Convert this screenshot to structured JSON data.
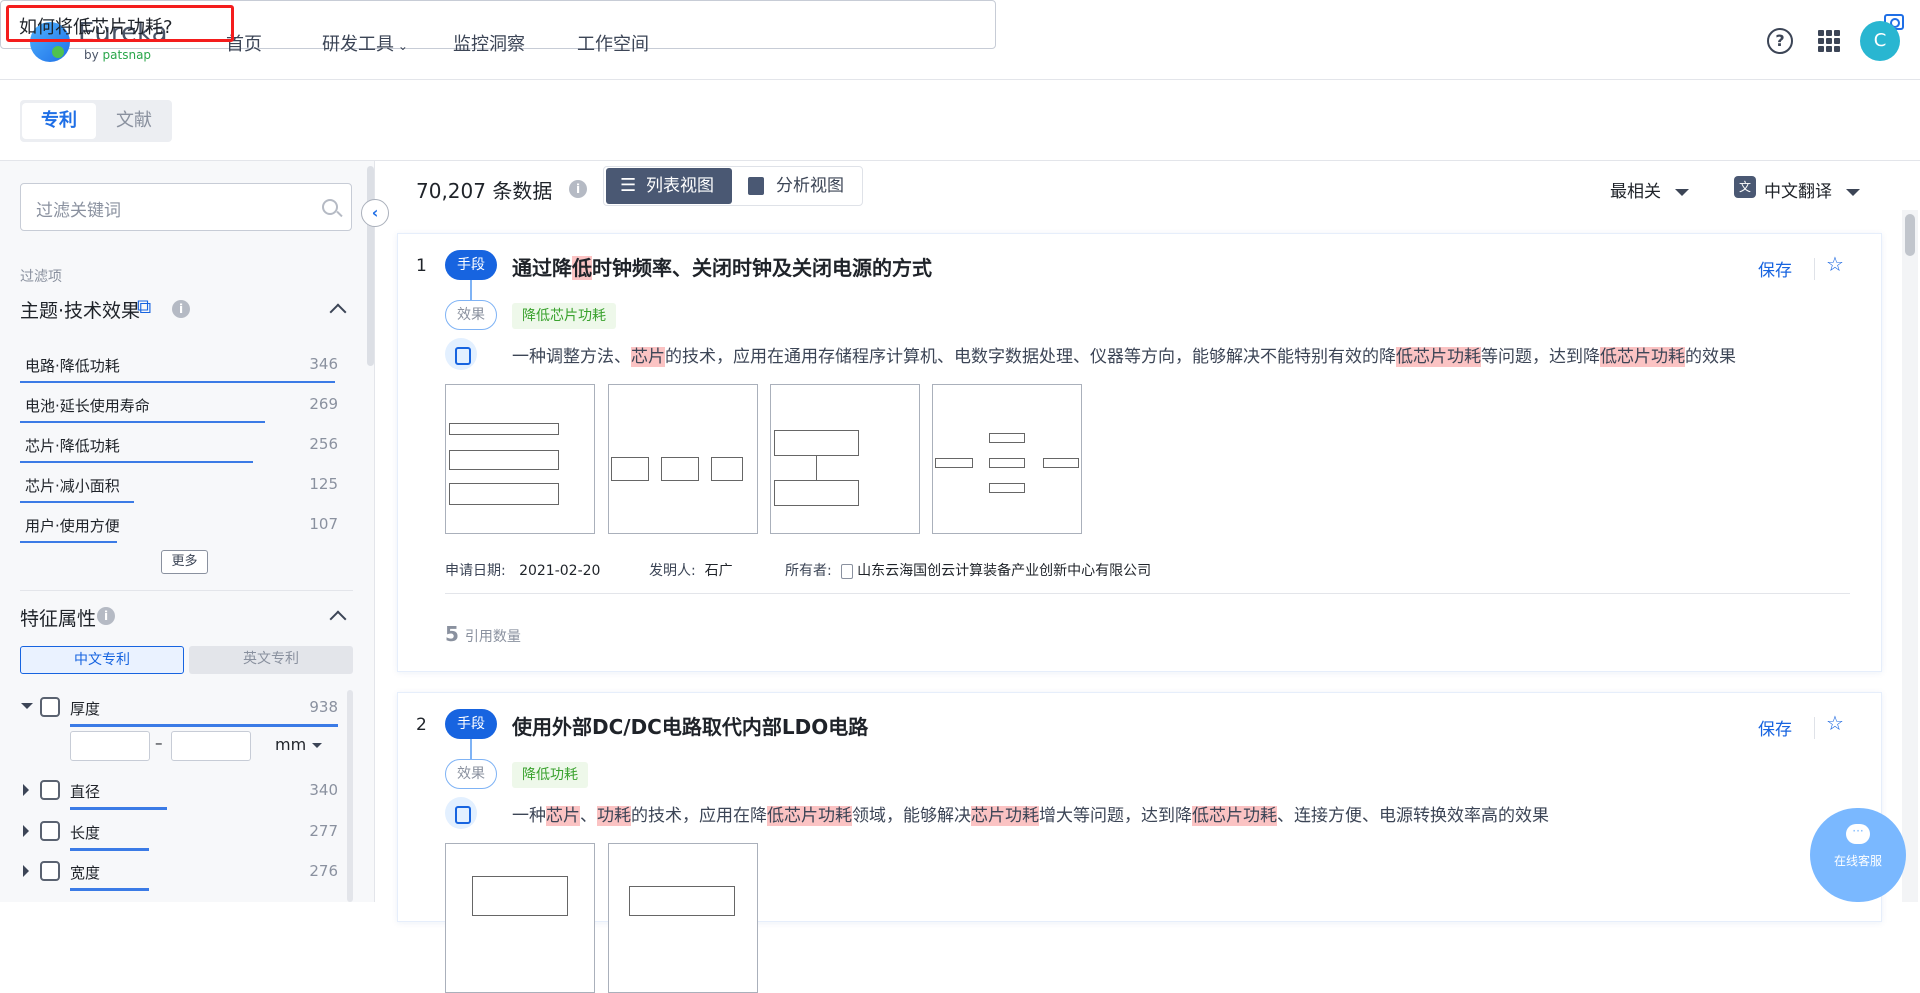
{
  "header": {
    "logo": "Eureka",
    "logo_sub_by": "by ",
    "logo_sub_brand": "patsnap",
    "nav": [
      "首页",
      "研发工具",
      "监控洞察",
      "工作空间"
    ],
    "search_value": "如何将低芯片功耗?",
    "avatar": "C",
    "help": "?"
  },
  "tabs": {
    "patent": "专利",
    "literature": "文献"
  },
  "sidebar": {
    "filter_placeholder": "过滤关键词",
    "filter_section": "过滤项",
    "topic_title": "主题·技术效果",
    "info": "i",
    "topics": [
      {
        "label": "电路·降低功耗",
        "count": 346
      },
      {
        "label": "电池·延长使用寿命",
        "count": 269
      },
      {
        "label": "芯片·降低功耗",
        "count": 256
      },
      {
        "label": "芯片·减小面积",
        "count": 125
      },
      {
        "label": "用户·使用方便",
        "count": 107
      }
    ],
    "more": "更多",
    "feature_title": "特征属性",
    "toggle_cn": "中文专利",
    "toggle_en": "英文专利",
    "attributes": [
      {
        "label": "厚度",
        "count": 938,
        "expanded": true
      },
      {
        "label": "直径",
        "count": 340
      },
      {
        "label": "长度",
        "count": 277
      },
      {
        "label": "宽度",
        "count": 276
      }
    ],
    "range_sep": "–",
    "unit": "mm"
  },
  "results": {
    "count": "70,207",
    "count_label": "条数据",
    "list_view": "列表视图",
    "analysis_view": "分析视图",
    "sort": "最相关",
    "translate": "中文翻译",
    "translate_icon": "文"
  },
  "cards": [
    {
      "index": "1",
      "method_badge": "手段",
      "effect_badge": "效果",
      "title": [
        [
          "通过降",
          false
        ],
        [
          "低",
          true
        ],
        [
          "时钟频率、关闭时钟及关闭电源的方式",
          false
        ]
      ],
      "effect_tag": "降低芯片功耗",
      "desc": [
        [
          "一种调整方法、",
          false
        ],
        [
          "芯片",
          true
        ],
        [
          "的技术，应用在通用存储程序计算机、电数字数据处理、仪器等方向，能够解决不能特别有效的降",
          false
        ],
        [
          "低芯片功耗",
          true
        ],
        [
          "等问题，达到降",
          false
        ],
        [
          "低芯片功耗",
          true
        ],
        [
          "的效果",
          false
        ]
      ],
      "save": "保存",
      "date_label": "申请日期:",
      "date": "2021-02-20",
      "inventor_label": "发明人:",
      "inventor": "石广",
      "owner_label": "所有者:",
      "owner": "山东云海国创云计算装备产业创新中心有限公司",
      "citations": "5",
      "citations_label": "引用数量"
    },
    {
      "index": "2",
      "method_badge": "手段",
      "effect_badge": "效果",
      "title": [
        [
          "使用外部DC/DC电路取代内部LDO电路",
          false
        ]
      ],
      "effect_tag": "降低功耗",
      "desc": [
        [
          "一种",
          false
        ],
        [
          "芯片",
          true
        ],
        [
          "、",
          false
        ],
        [
          "功耗",
          true
        ],
        [
          "的技术，应用在降",
          false
        ],
        [
          "低芯片功耗",
          true
        ],
        [
          "领域，能够解决",
          false
        ],
        [
          "芯片功耗",
          true
        ],
        [
          "增大等问题，达到降",
          false
        ],
        [
          "低芯片功耗",
          true
        ],
        [
          "、连接方便、电源转换效率高的效果",
          false
        ]
      ],
      "save": "保存"
    }
  ],
  "chat": {
    "label": "在线客服"
  }
}
